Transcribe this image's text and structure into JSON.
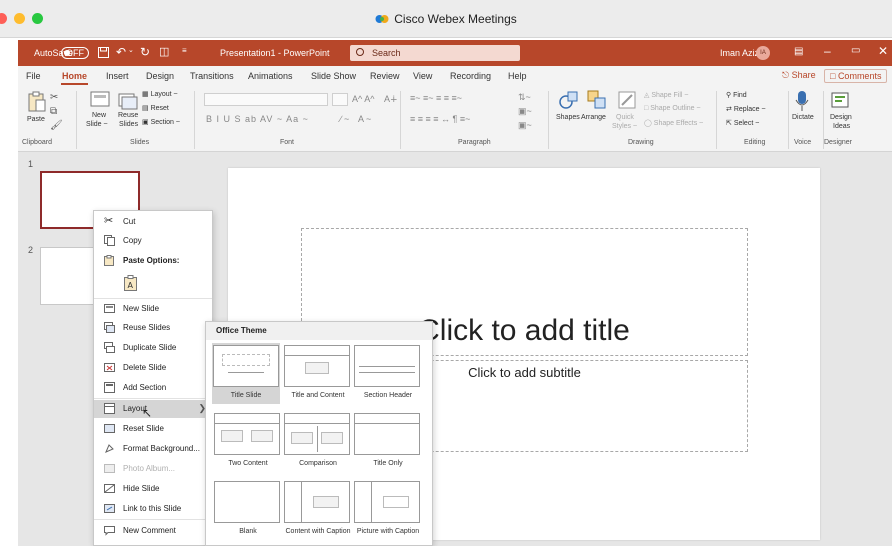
{
  "window": {
    "title": "Cisco Webex Meetings",
    "traffic_lights": {
      "close": "#fe5f57",
      "minimize": "#febc2e",
      "maximize": "#28c840"
    }
  },
  "titlebar": {
    "autosave_label": "AutoSave",
    "autosave_state": "OFF",
    "document_title": "Presentation1  -  PowerPoint",
    "search_placeholder": "Search",
    "user_name": "Iman Aziz",
    "user_initials": "IA",
    "accent_color": "#b7472a"
  },
  "tabs": [
    "File",
    "Home",
    "Insert",
    "Design",
    "Transitions",
    "Animations",
    "Slide Show",
    "Review",
    "View",
    "Recording",
    "Help"
  ],
  "active_tab": "Home",
  "share_label": "Share",
  "comments_label": "Comments",
  "ribbon": {
    "clipboard": {
      "paste": "Paste",
      "group": "Clipboard"
    },
    "slides": {
      "new_slide_1": "New",
      "new_slide_2": "Slide ~",
      "reuse_1": "Reuse",
      "reuse_2": "Slides",
      "layout": "Layout ~",
      "reset": "Reset",
      "section": "Section ~",
      "group": "Slides"
    },
    "font": {
      "group": "Font",
      "letters": "B  I  U  S  ab  AV ~  Aa ~",
      "grow": "A^  A^"
    },
    "paragraph": {
      "group": "Paragraph"
    },
    "drawing": {
      "shapes": "Shapes",
      "arrange": "Arrange",
      "quick_1": "Quick",
      "quick_2": "Styles ~",
      "shape_fill": "Shape Fill ~",
      "shape_outline": "Shape Outline ~",
      "shape_effects": "Shape Effects ~",
      "group": "Drawing"
    },
    "editing": {
      "find": "Find",
      "replace": "Replace  ~",
      "select": "Select ~",
      "group": "Editing"
    },
    "voice": {
      "dictate": "Dictate",
      "group": "Voice"
    },
    "designer": {
      "ideas_1": "Design",
      "ideas_2": "Ideas",
      "group": "Designer"
    }
  },
  "thumbnails": [
    "1",
    "2"
  ],
  "slide": {
    "title_placeholder": "Click to add title",
    "subtitle_placeholder": "Click to add subtitle"
  },
  "context_menu": {
    "items": [
      {
        "label": "Cut",
        "icon": "scissors-icon"
      },
      {
        "label": "Copy",
        "icon": "copy-icon"
      },
      {
        "label": "Paste Options:",
        "icon": "paste-icon",
        "bold": true
      },
      {
        "label": "New Slide",
        "icon": "new-slide-icon"
      },
      {
        "label": "Reuse Slides",
        "icon": "reuse-slides-icon"
      },
      {
        "label": "Duplicate Slide",
        "icon": "duplicate-slide-icon"
      },
      {
        "label": "Delete Slide",
        "icon": "delete-slide-icon"
      },
      {
        "label": "Add Section",
        "icon": "add-section-icon"
      },
      {
        "label": "Layout",
        "icon": "layout-icon",
        "has_submenu": true,
        "highlighted": true
      },
      {
        "label": "Reset Slide",
        "icon": "reset-slide-icon"
      },
      {
        "label": "Format Background...",
        "icon": "format-background-icon"
      },
      {
        "label": "Photo Album...",
        "icon": "photo-album-icon",
        "disabled": true
      },
      {
        "label": "Hide Slide",
        "icon": "hide-slide-icon"
      },
      {
        "label": "Link to this Slide",
        "icon": "link-icon"
      },
      {
        "label": "New Comment",
        "icon": "comment-icon"
      }
    ]
  },
  "layout_submenu": {
    "header": "Office Theme",
    "layouts": [
      {
        "label": "Title Slide",
        "selected": true
      },
      {
        "label": "Title and Content"
      },
      {
        "label": "Section Header"
      },
      {
        "label": "Two Content"
      },
      {
        "label": "Comparison"
      },
      {
        "label": "Title Only"
      },
      {
        "label": "Blank"
      },
      {
        "label": "Content with Caption"
      },
      {
        "label": "Picture with Caption"
      }
    ]
  }
}
